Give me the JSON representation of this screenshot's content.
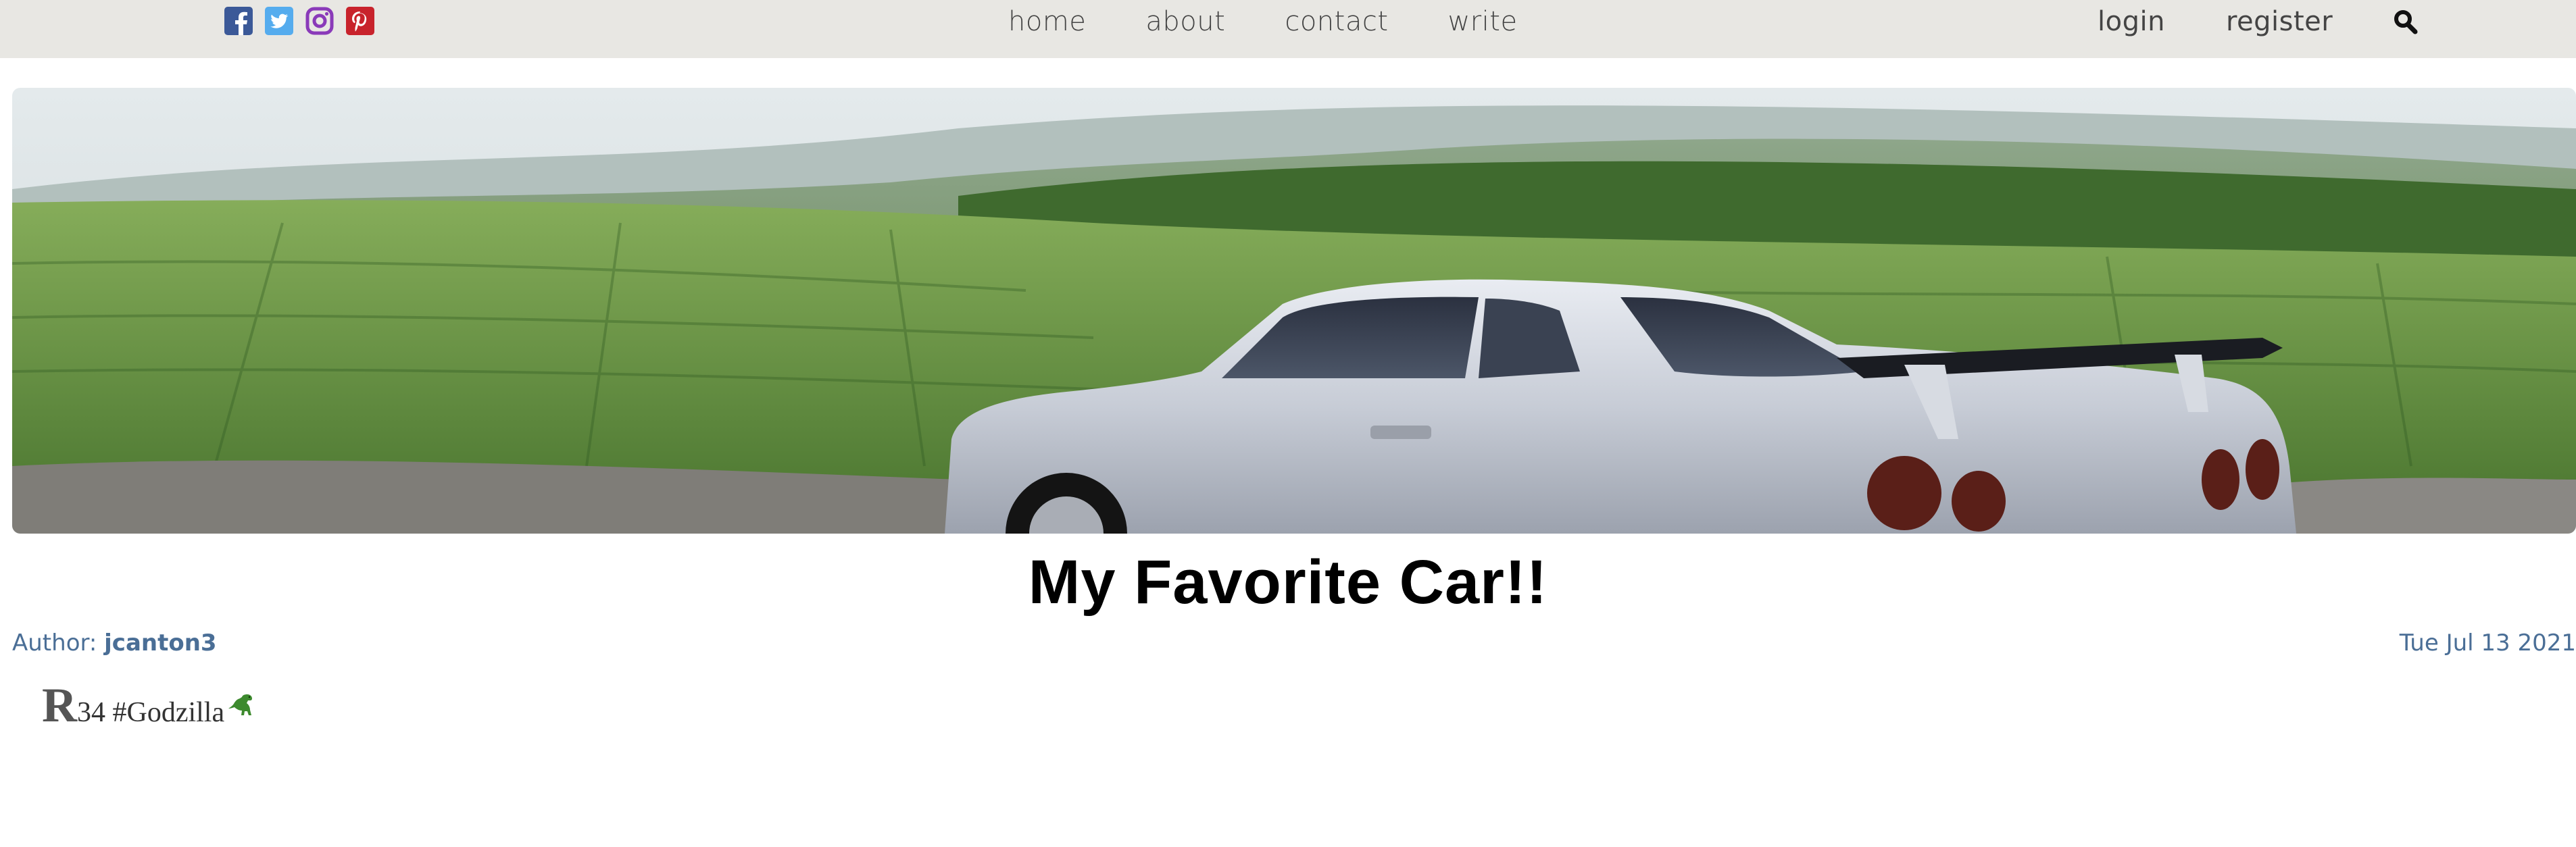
{
  "social": {
    "icons": [
      "facebook-icon",
      "twitter-icon",
      "instagram-icon",
      "pinterest-icon"
    ],
    "colors": {
      "facebook": "#3b5998",
      "twitter": "#55acee",
      "instagram": "#8a3ab9",
      "pinterest": "#c8232c"
    }
  },
  "nav": {
    "home": "home",
    "about": "about",
    "contact": "contact",
    "write": "write"
  },
  "auth": {
    "login": "login",
    "register": "register",
    "search_icon": "search-icon"
  },
  "post": {
    "title": "My Favorite Car!!",
    "author_label": "Author:",
    "author_name": "jcanton3",
    "date": "Tue Jul 13 2021",
    "dropcap": "R",
    "body": "34 #Godzilla",
    "emoji": "dinosaur-icon"
  },
  "colors": {
    "topbar_bg": "#e8e7e3",
    "meta_text": "#4a6e96",
    "nav_text": "#444444"
  }
}
